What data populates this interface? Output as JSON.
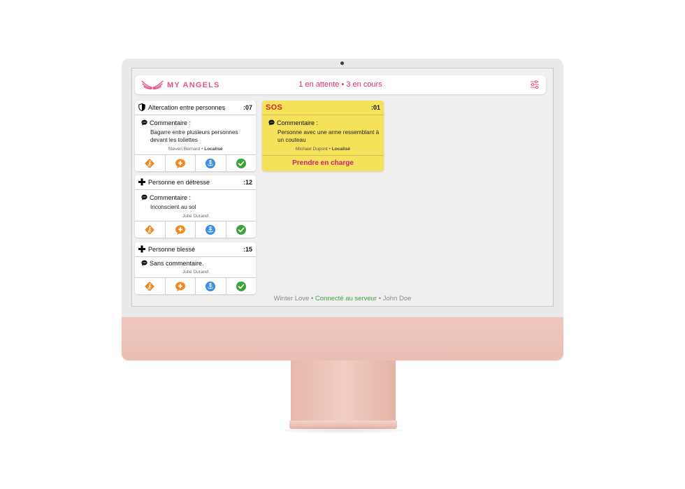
{
  "app": {
    "brand": "MY ANGELS",
    "status_summary": "1 en attente • 3 en cours",
    "accent_color": "#e5558b",
    "logo_icon": "angel-wings-icon",
    "settings_icon": "sliders-icon"
  },
  "sos_card": {
    "label": "SOS",
    "time": ":01",
    "comment_label": "Commentaire :",
    "comment": "Personne avec une arme ressemblant à un couteau",
    "author": "Michael Dupont",
    "located": "Localisé",
    "action_label": "Prendre en charge",
    "background": "#f5e15a"
  },
  "cards": [
    {
      "title": "Altercation entre personnes",
      "time": ":07",
      "icon": "shield-icon",
      "comment_label": "Commentaire :",
      "comment": "Bagarre entre plusieurs personnes devant les toilettes",
      "author": "Steven Bernard",
      "located": "Localisé"
    },
    {
      "title": "Personne en détresse",
      "time": ":12",
      "icon": "medical-cross-icon",
      "comment_label": "Commentaire :",
      "comment": "Inconscient au sol",
      "author": "Julie Durand"
    },
    {
      "title": "Personne blessé",
      "time": ":15",
      "icon": "medical-cross-icon",
      "comment_label": "Sans commentaire.",
      "author": "Julie Durand"
    }
  ],
  "card_actions": [
    "directions-icon",
    "medical-help-icon",
    "anchor-icon",
    "check-icon"
  ],
  "footer": {
    "event": "Winter Love",
    "separator": "•",
    "connection": "Connecté au serveur",
    "user": "John Doe"
  }
}
